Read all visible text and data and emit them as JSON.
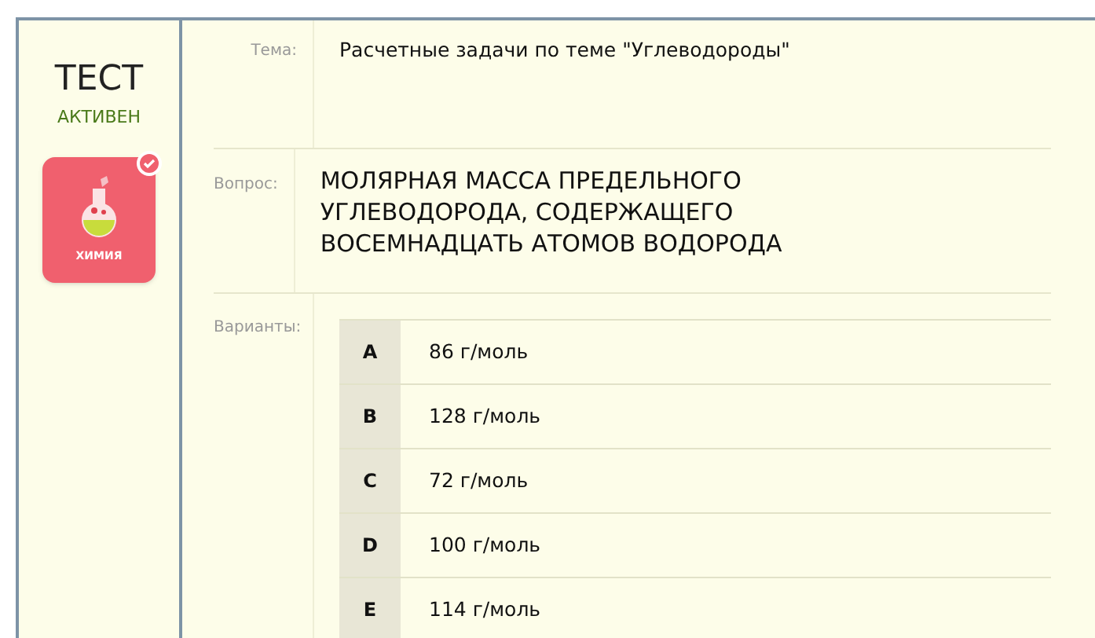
{
  "test": {
    "title": "ТЕСТ",
    "status": "АКТИВЕН",
    "subject": {
      "label": "ХИМИЯ",
      "completed": true
    }
  },
  "topic": {
    "label": "Тема:",
    "value": "Расчетные задачи по теме \"Углеводороды\""
  },
  "question": {
    "label": "Вопрос:",
    "value": "МОЛЯРНАЯ МАССА ПРЕДЕЛЬНОГО УГЛЕВОДОРОДА, СОДЕРЖАЩЕГО ВОСЕМНАДЦАТЬ АТОМОВ ВОДОРОДА"
  },
  "variants": {
    "label": "Варианты:",
    "options": [
      {
        "letter": "A",
        "text": "86 г/моль"
      },
      {
        "letter": "B",
        "text": "128 г/моль"
      },
      {
        "letter": "C",
        "text": "72 г/моль"
      },
      {
        "letter": "D",
        "text": "100 г/моль"
      },
      {
        "letter": "E",
        "text": "114 г/моль"
      }
    ]
  }
}
